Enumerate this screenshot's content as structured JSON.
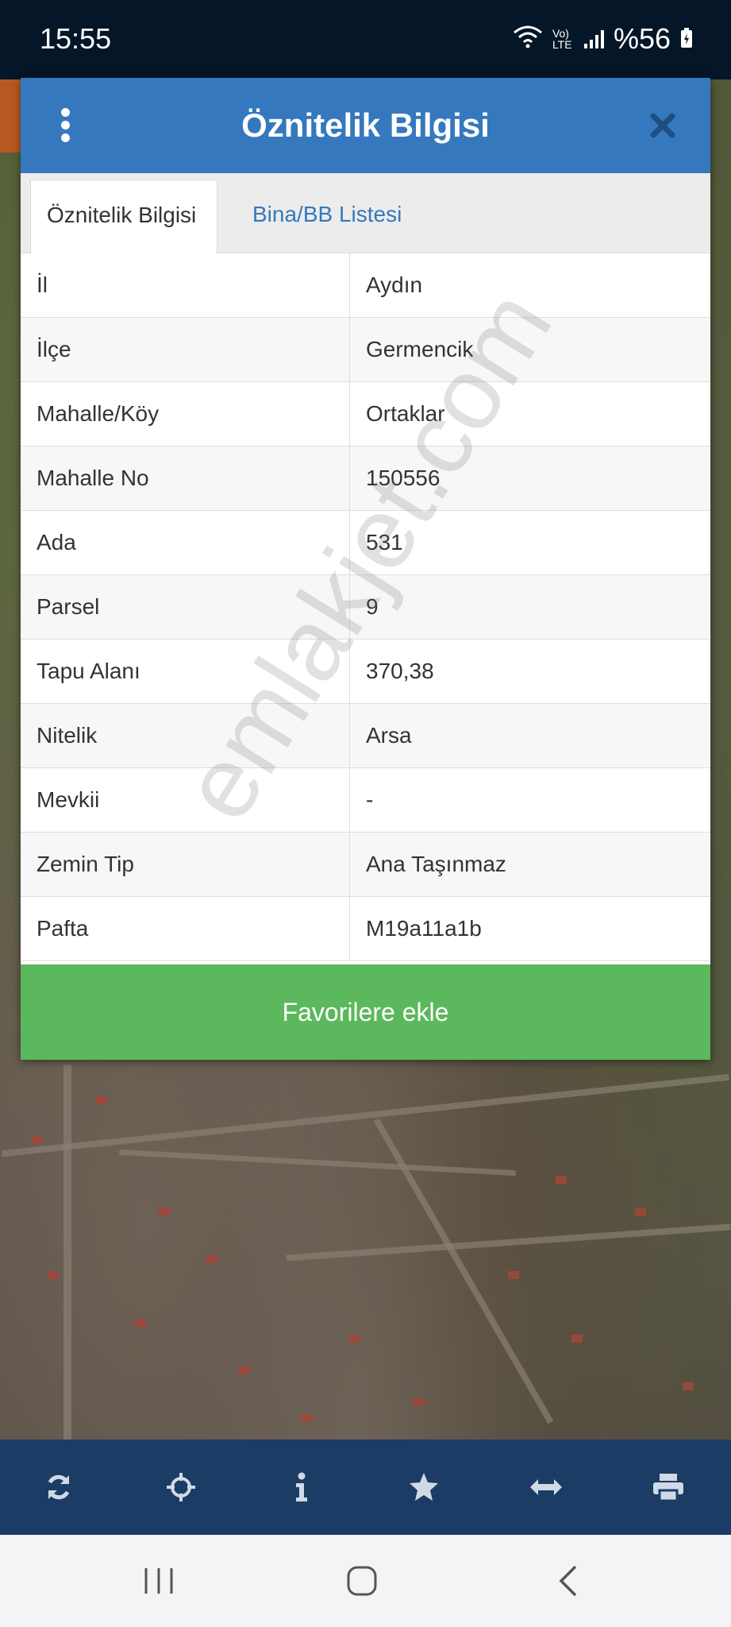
{
  "status_bar": {
    "time": "15:55",
    "network_label": "Vo) LTE",
    "battery": "%56"
  },
  "dialog": {
    "title": "Öznitelik Bilgisi",
    "tabs": [
      {
        "label": "Öznitelik Bilgisi",
        "active": true
      },
      {
        "label": "Bina/BB Listesi",
        "active": false
      }
    ],
    "rows": [
      {
        "key": "İl",
        "value": "Aydın"
      },
      {
        "key": "İlçe",
        "value": "Germencik"
      },
      {
        "key": "Mahalle/Köy",
        "value": "Ortaklar"
      },
      {
        "key": "Mahalle No",
        "value": "150556"
      },
      {
        "key": "Ada",
        "value": "531"
      },
      {
        "key": "Parsel",
        "value": "9"
      },
      {
        "key": "Tapu Alanı",
        "value": "370,38"
      },
      {
        "key": "Nitelik",
        "value": "Arsa"
      },
      {
        "key": "Mevkii",
        "value": "-"
      },
      {
        "key": "Zemin Tip",
        "value": "Ana Taşınmaz"
      },
      {
        "key": "Pafta",
        "value": "M19a11a1b"
      }
    ],
    "favorite_button": "Favorilere ekle"
  },
  "watermark": "emlakjet.com",
  "toolbar": {
    "icons": [
      "refresh-icon",
      "crosshair-icon",
      "info-icon",
      "star-icon",
      "measure-icon",
      "print-icon"
    ]
  },
  "colors": {
    "header_blue": "#3578be",
    "favorite_green": "#5cb85c",
    "toolbar_navy": "#1b3c65",
    "status_bar": "#041628"
  }
}
